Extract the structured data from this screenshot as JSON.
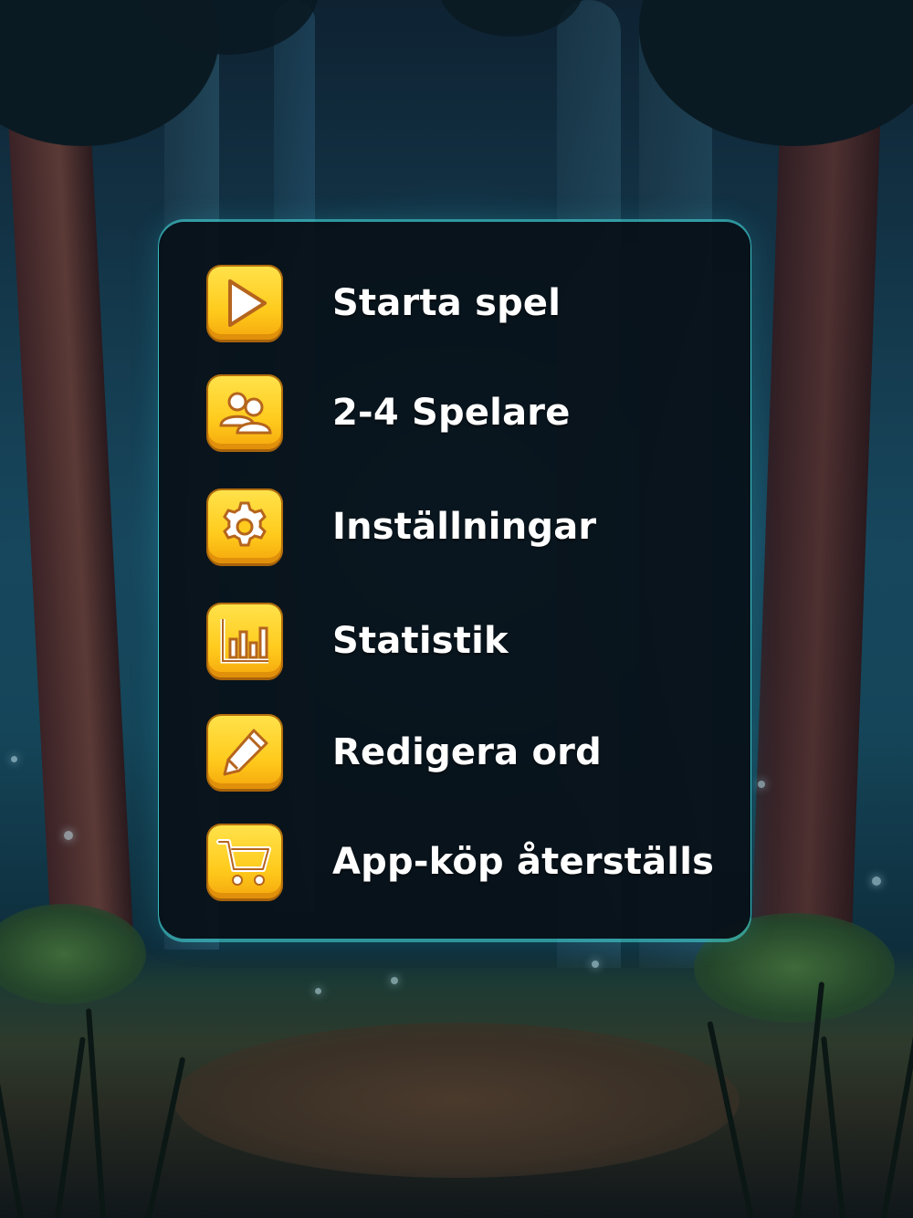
{
  "background": {
    "scene": "night-forest",
    "accent_color": "#46dcdc",
    "panel_color": "#081018"
  },
  "menu": {
    "items": [
      {
        "id": "start",
        "label": "Starta spel",
        "icon": "play-icon"
      },
      {
        "id": "players",
        "label": "2-4 Spelare",
        "icon": "players-icon"
      },
      {
        "id": "settings",
        "label": "Inställningar",
        "icon": "gear-icon"
      },
      {
        "id": "statistics",
        "label": "Statistik",
        "icon": "bar-chart-icon"
      },
      {
        "id": "edit-words",
        "label": "Redigera ord",
        "icon": "pencil-icon"
      },
      {
        "id": "restore",
        "label": "App-köp återställs",
        "icon": "cart-icon"
      }
    ],
    "icon_tile_color": "#ffcb1d"
  }
}
